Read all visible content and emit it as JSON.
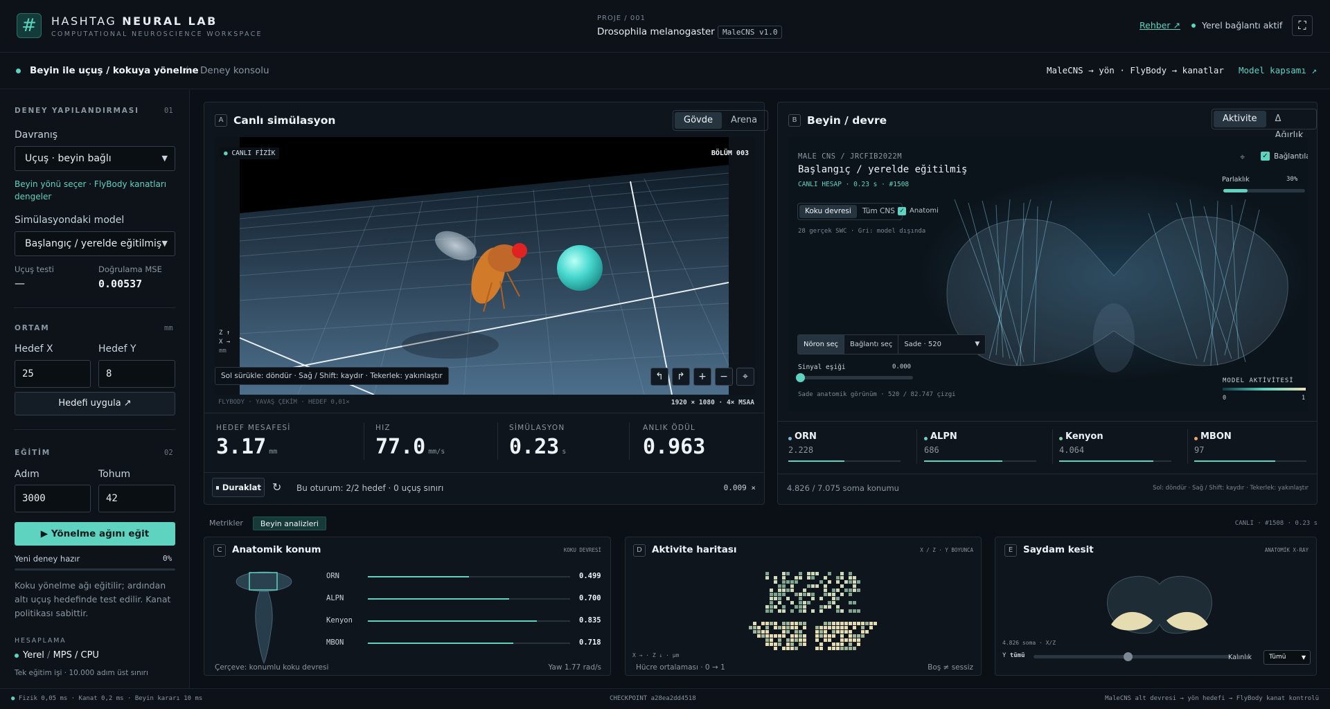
{
  "header": {
    "logo_glyph": "#",
    "brand_light": "HASHTAG",
    "brand_bold": "NEURAL LAB",
    "brand_sub": "COMPUTATIONAL NEUROSCIENCE WORKSPACE",
    "project_label": "PROJE / 001",
    "project_name": "Drosophila melanogaster",
    "project_version": "MaleCNS v1.0",
    "guide_link": "Rehber ↗",
    "connection_status": "Yerel bağlantı aktif",
    "fullscreen_icon": "fullscreen-icon"
  },
  "subbar": {
    "title": "Beyin ile uçuş / kokuya yönelme",
    "separator": "/",
    "console": "Deney konsolu",
    "pipeline": "MaleCNS → yön · FlyBody → kanatlar",
    "scope_link": "Model kapsamı ↗"
  },
  "sidebar": {
    "config_title": "DENEY YAPILANDIRMASI",
    "config_num": "01",
    "behavior_label": "Davranış",
    "behavior_value": "Uçuş · beyin bağlı",
    "behavior_hint": "Beyin yönü seçer · FlyBody kanatları dengeler",
    "model_label": "Simülasyondaki model",
    "model_value": "Başlangıç / yerelde eğitilmiş",
    "flight_test_label": "Uçuş testi",
    "flight_test_value": "—",
    "mse_label": "Doğrulama MSE",
    "mse_value": "0.00537",
    "env_title": "ORTAM",
    "env_unit": "mm",
    "target_x_label": "Hedef X",
    "target_x_value": "25",
    "target_y_label": "Hedef Y",
    "target_y_value": "8",
    "apply_target": "Hedefi uygula ↗",
    "train_title": "EĞİTİM",
    "train_num": "02",
    "steps_label": "Adım",
    "steps_value": "3000",
    "seed_label": "Tohum",
    "seed_value": "42",
    "train_button": "▶  Yönelme ağını eğit",
    "status_text": "Yeni deney hazır",
    "status_percent": "0%",
    "progress": 0,
    "description": "Koku yönelme ağı eğitilir; ardından altı uçuş hedefinde test edilir. Kanat politikası sabittir.",
    "compute_title": "HESAPLAMA",
    "compute_local": "Yerel",
    "compute_sep": "/",
    "compute_device": "MPS / CPU",
    "compute_note": "Tek eğitim işi · 10.000 adım üst sınırı"
  },
  "sim": {
    "tag": "A",
    "title": "Canlı simülasyon",
    "tabs": [
      "Gövde",
      "Arena"
    ],
    "active_tab": 0,
    "live_badge": "CANLI FİZİK",
    "episode": "BÖLÜM 003",
    "axis_legend": [
      "Z ↑",
      "X →",
      "mm"
    ],
    "hint": "Sol sürükle: döndür · Sağ / Shift: kaydır · Tekerlek: yakınlaştır",
    "caption_left": "FLYBODY  ·  YAVAŞ ÇEKİM  · HEDEF 0,01×",
    "caption_right": "1920 × 1080 · 4× MSAA",
    "stats": [
      {
        "label": "HEDEF MESAFESİ",
        "value": "3.17",
        "unit": "mm"
      },
      {
        "label": "HIZ",
        "value": "77.0",
        "unit": "mm/s"
      },
      {
        "label": "SİMÜLASYON",
        "value": "0.23",
        "unit": "s"
      },
      {
        "label": "ANLIK ÖDÜL",
        "value": "0.963",
        "unit": ""
      }
    ],
    "pause_button": "⏸ Duraklat",
    "session_text": "Bu oturum: 2/2 hedef · 0 uçuş sınırı",
    "speed": "0.009 ×"
  },
  "brain": {
    "tag": "B",
    "title": "Beyin / devre",
    "tabs": [
      "Aktivite",
      "Δ Ağırlık"
    ],
    "active_tab": 0,
    "dataset": "MALE CNS / JRCFIB2022M",
    "model_title": "Başlangıç / yerelde eğitilmiş",
    "live_calc": "CANLI HESAP · 0.23 s · #1508",
    "connections_label": "Bağlantılar",
    "brightness_label": "Parlaklık",
    "brightness_value": "30%",
    "brightness": 0.3,
    "subtabs": [
      "Koku devresi",
      "Tüm CNS"
    ],
    "anatomy_label": "Anatomi",
    "swc_note": "28 gerçek SWC · Gri: model dışında",
    "neuron_select": "Nöron seç",
    "connection_select": "Bağlantı seç",
    "simple_select": "Sade · 520",
    "threshold_label": "Sinyal eşiği",
    "threshold_value": "0.000",
    "view_note": "Sade anatomik görünüm · 520 / 82.747 çizgi",
    "activity_label": "MODEL AKTİVİTESİ",
    "activity_min": "0",
    "activity_max": "1",
    "cells": [
      {
        "name": "ORN",
        "count": "2.228",
        "color": "#7fb8d8",
        "fill": 0.5
      },
      {
        "name": "ALPN",
        "count": "686",
        "color": "#6fd0c8",
        "fill": 0.7
      },
      {
        "name": "Kenyon",
        "count": "4.064",
        "color": "#8fd6a8",
        "fill": 0.84
      },
      {
        "name": "MBON",
        "count": "97",
        "color": "#f0a860",
        "fill": 0.72
      }
    ],
    "soma_count": "4.826 / 7.075 soma konumu",
    "controls_hint": "Sol: döndür · Sağ / Shift: kaydır · Tekerlek: yakınlaştır"
  },
  "analysis": {
    "tabs": [
      "Metrikler",
      "Beyin analizleri"
    ],
    "active_tab": 1,
    "live_info": "CANLI · #1508 · 0.23 s",
    "anat": {
      "tag": "C",
      "title": "Anatomik konum",
      "badge": "KOKU DEVRESİ",
      "rows": [
        {
          "name": "ORN",
          "value": "0.499",
          "fill": 0.499
        },
        {
          "name": "ALPN",
          "value": "0.700",
          "fill": 0.7
        },
        {
          "name": "Kenyon",
          "value": "0.835",
          "fill": 0.835
        },
        {
          "name": "MBON",
          "value": "0.718",
          "fill": 0.718
        }
      ],
      "frame_note": "Çerçeve: konumlu koku devresi",
      "yaw": "Yaw 1.77 rad/s"
    },
    "heat": {
      "tag": "D",
      "title": "Aktivite haritası",
      "badge": "X / Z · Y BOYUNCA",
      "axes": "X → · Z ↓ · µm",
      "avg": "Hücre ortalaması · 0 → 1",
      "empty": "Boş ≠ sessiz"
    },
    "xray": {
      "tag": "E",
      "title": "Saydam kesit",
      "badge": "ANATOMİK X-RAY",
      "soma": "4.826 soma · X/Z",
      "y_label": "Y",
      "y_value": "tümü",
      "thickness": "Kalınlık",
      "all_select": "Tümü"
    }
  },
  "footer": {
    "timing": "Fizik 0,05 ms · Kanat 0,2 ms · Beyin kararı 10 ms",
    "checkpoint": "CHECKPOINT a28ea2dd4518",
    "right": "MaleCNS alt devresi → yön hedefi → FlyBody kanat kontrolü"
  },
  "colors": {
    "accent": "#5ed3c0",
    "background": "#0b1016",
    "panel": "#0e151c",
    "target_sphere": "#48d8cf",
    "fly_body": "#d07a2a"
  }
}
